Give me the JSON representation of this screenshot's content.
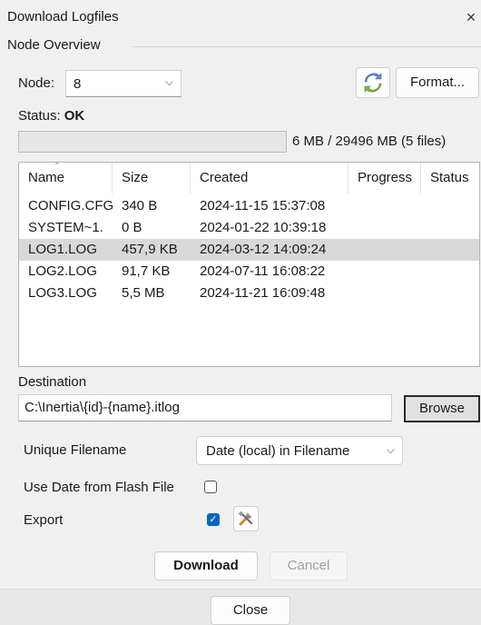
{
  "window": {
    "title": "Download Logfiles",
    "close_glyph": "×"
  },
  "group": {
    "label": "Node Overview"
  },
  "node": {
    "label": "Node:",
    "value": "8"
  },
  "toolbar": {
    "refresh_icon": "refresh-icon",
    "format_label": "Format..."
  },
  "status": {
    "label": "Status:",
    "value": "OK"
  },
  "storage": {
    "used_fraction": 0.0002,
    "text": "6 MB  /  29496 MB  (5 files)",
    "progress_color": "#06b025"
  },
  "file_list": {
    "columns": [
      "Name",
      "Size",
      "Created",
      "Progress",
      "Status"
    ],
    "rows": [
      {
        "name": "CONFIG.CFG",
        "size": "340 B",
        "created": "2024-11-15 15:37:08",
        "progress": "",
        "status": "",
        "selected": false
      },
      {
        "name": "SYSTEM~1.",
        "size": "0 B",
        "created": "2024-01-22 10:39:18",
        "progress": "",
        "status": "",
        "selected": false
      },
      {
        "name": "LOG1.LOG",
        "size": "457,9 KB",
        "created": "2024-03-12 14:09:24",
        "progress": "",
        "status": "",
        "selected": true
      },
      {
        "name": "LOG2.LOG",
        "size": "91,7 KB",
        "created": "2024-07-11 16:08:22",
        "progress": "",
        "status": "",
        "selected": false
      },
      {
        "name": "LOG3.LOG",
        "size": "5,5 MB",
        "created": "2024-11-21 16:09:48",
        "progress": "",
        "status": "",
        "selected": false
      }
    ]
  },
  "destination": {
    "label": "Destination",
    "value": "C:\\Inertia\\{id}-{name}.itlog",
    "browse_label": "Browse"
  },
  "options": {
    "unique_filename_label": "Unique Filename",
    "unique_filename_value": "Date (local) in Filename",
    "use_date_label": "Use Date from Flash File",
    "use_date_checked": false,
    "export_label": "Export",
    "export_checked": true,
    "export_settings_icon": "tools-icon"
  },
  "actions": {
    "download_label": "Download",
    "cancel_label": "Cancel",
    "close_label": "Close"
  },
  "colors": {
    "accent": "#0067c0",
    "selected_row": "#d9d9d9"
  }
}
